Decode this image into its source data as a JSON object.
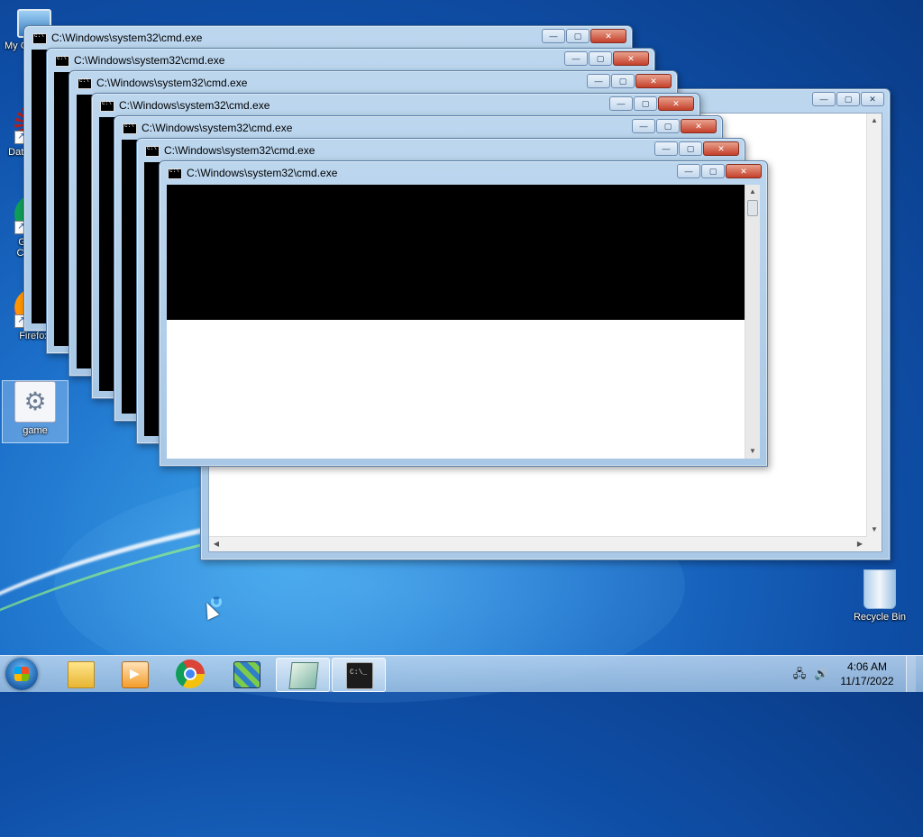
{
  "desktop": {
    "icons": [
      {
        "label": "My Computer",
        "icon": "computer-icon"
      },
      {
        "label": "DataWagon",
        "icon": "datawagon-icon"
      },
      {
        "label": "Google Chrome",
        "icon": "chrome-icon"
      },
      {
        "label": "Firefox",
        "icon": "firefox-icon"
      },
      {
        "label": "game",
        "icon": "game-settings-icon"
      },
      {
        "label": "Recycle Bin",
        "icon": "recycle-bin-icon"
      }
    ]
  },
  "windows": [
    {
      "title": "C:\\Windows\\system32\\cmd.exe"
    },
    {
      "title": "C:\\Windows\\system32\\cmd.exe"
    },
    {
      "title": "C:\\Windows\\system32\\cmd.exe"
    },
    {
      "title": "C:\\Windows\\system32\\cmd.exe"
    },
    {
      "title": "C:\\Windows\\system32\\cmd.exe"
    },
    {
      "title": "C:\\Windows\\system32\\cmd.exe"
    },
    {
      "title": "C:\\Windows\\system32\\cmd.exe"
    }
  ],
  "controls": {
    "minimize": "—",
    "maximize": "▢",
    "close": "✕"
  },
  "scroll": {
    "up": "▲",
    "down": "▼",
    "left": "◀",
    "right": "▶"
  },
  "taskbar": {
    "apps": [
      "start-orb",
      "file-explorer",
      "media-player",
      "google-chrome",
      "game-launcher",
      "notepad",
      "command-prompt"
    ],
    "tray": {
      "network_icon": "network-icon",
      "volume_icon": "volume-icon"
    },
    "clock": {
      "time": "4:06 AM",
      "date": "11/17/2022"
    }
  }
}
